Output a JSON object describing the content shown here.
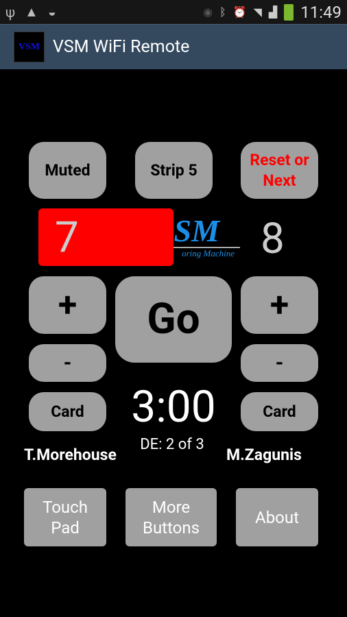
{
  "status_bar": {
    "time": "11:49",
    "icons": [
      "usb-icon",
      "warning-icon",
      "wifi-lock-icon",
      "eye-icon",
      "bluetooth-icon",
      "alarm-icon",
      "wifi-icon",
      "signal-icon",
      "battery-charging-icon"
    ]
  },
  "app_bar": {
    "logo_text": "VSM",
    "title": "VSM WiFi Remote"
  },
  "top_buttons": {
    "muted": "Muted",
    "strip": "Strip 5",
    "reset": "Reset or Next"
  },
  "scores": {
    "left": "7",
    "right": "8",
    "left_color": "#ff0000"
  },
  "logo": {
    "big": "SM",
    "small": "oring Machine"
  },
  "controls": {
    "plus": "+",
    "minus": "-",
    "go": "Go",
    "card": "Card"
  },
  "timer": "3:00",
  "bout": "DE: 2 of 3",
  "fencers": {
    "left": "T.Morehouse",
    "right": "M.Zagunis"
  },
  "bottom_buttons": {
    "touch_pad": "Touch Pad",
    "more_buttons": "More Buttons",
    "about": "About"
  }
}
